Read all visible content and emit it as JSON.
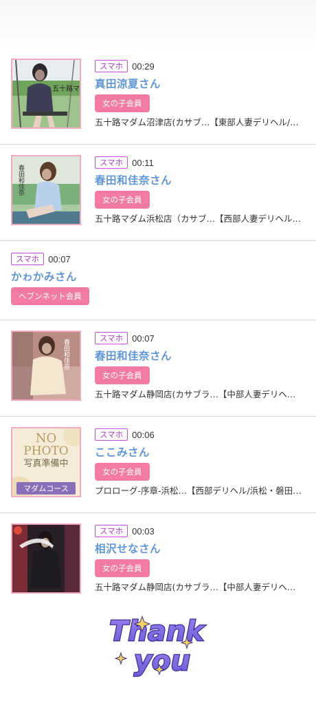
{
  "entries": [
    {
      "device": "スマホ",
      "time": "00:29",
      "name": "真田涼夏さん",
      "member_type": "女の子会員",
      "shop": "五十路マダム沼津店(カサブ…【東部人妻デリヘル/…",
      "thumb_text": "五十路マダム"
    },
    {
      "device": "スマホ",
      "time": "00:11",
      "name": "春田和佳奈さん",
      "member_type": "女の子会員",
      "shop": "五十路マダム浜松店（カサブ…【西部人妻デリヘル…",
      "thumb_text": "春田和佳奈"
    },
    {
      "device": "スマホ",
      "time": "00:07",
      "name": "かゎかみさん",
      "member_type": "ヘブンネット会員"
    },
    {
      "device": "スマホ",
      "time": "00:07",
      "name": "春田和佳奈さん",
      "member_type": "女の子会員",
      "shop": "五十路マダム静岡店(カサブラ…【中部人妻デリヘ…",
      "thumb_text": "春田和佳奈"
    },
    {
      "device": "スマホ",
      "time": "00:06",
      "name": "ここみさん",
      "member_type": "女の子会員",
      "shop": "プロローグ-序章-浜松…【西部デリヘル/浜松・磐田…",
      "thumb_text_1": "NO",
      "thumb_text_2": "PHOTO",
      "thumb_text_3": "写真準備中",
      "thumb_text_4": "マダムコース"
    },
    {
      "device": "スマホ",
      "time": "00:03",
      "name": "相沢せなさん",
      "member_type": "女の子会員",
      "shop": "五十路マダム静岡店(カサブラ…【中部人妻デリヘ…"
    }
  ],
  "footer": {
    "thanks_line1": "Thank",
    "thanks_line2": "you"
  },
  "colors": {
    "device_badge": "#b63ed0",
    "name": "#5f96d8",
    "member_button": "#f27aa3",
    "thumb_border": "#f3a9c0"
  }
}
